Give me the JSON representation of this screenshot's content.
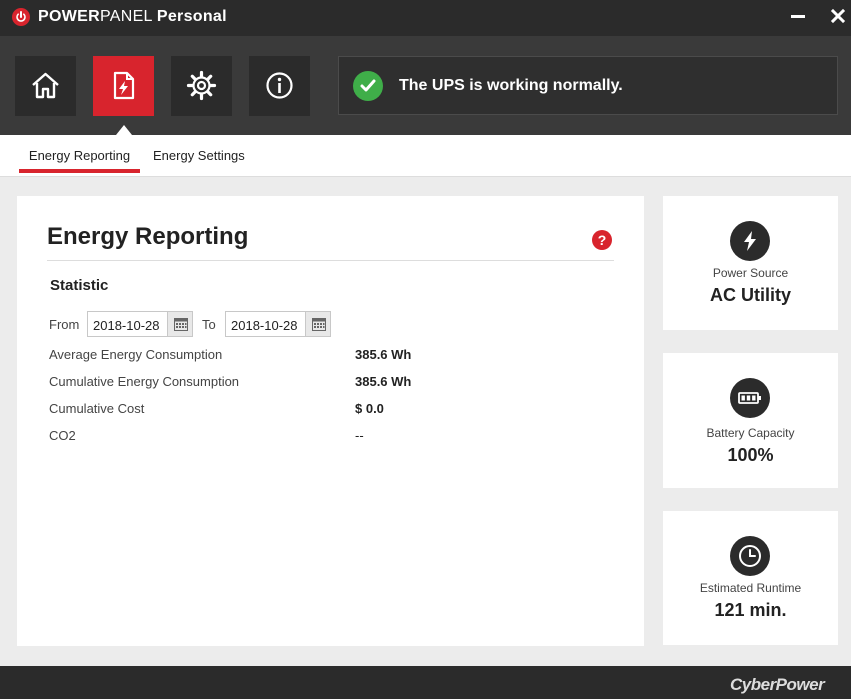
{
  "window": {
    "title_part1": "POWER",
    "title_part2": "PANEL",
    "title_part3": "Personal"
  },
  "nav": {
    "items": [
      {
        "icon": "home-icon"
      },
      {
        "icon": "energy-report-icon",
        "active": true
      },
      {
        "icon": "gear-icon"
      },
      {
        "icon": "info-icon"
      }
    ]
  },
  "status": {
    "message": "The UPS is working normally.",
    "color": "#3fae49"
  },
  "tabs": [
    {
      "label": "Energy Reporting",
      "active": true
    },
    {
      "label": "Energy Settings"
    }
  ],
  "main": {
    "title": "Energy Reporting",
    "help": "?",
    "section": "Statistic",
    "from_label": "From",
    "to_label": "To",
    "from_date": "2018-10-28",
    "to_date": "2018-10-28",
    "stats": [
      {
        "label": "Average Energy Consumption",
        "value": "385.6 Wh"
      },
      {
        "label": "Cumulative Energy Consumption",
        "value": "385.6 Wh"
      },
      {
        "label": "Cumulative Cost",
        "value": "$ 0.0"
      },
      {
        "label": "CO2",
        "value": "--"
      }
    ]
  },
  "cards": [
    {
      "icon": "lightning-icon",
      "label": "Power Source",
      "value": "AC Utility"
    },
    {
      "icon": "battery-icon",
      "label": "Battery Capacity",
      "value": "100%"
    },
    {
      "icon": "clock-icon",
      "label": "Estimated Runtime",
      "value": "121 min."
    }
  ],
  "footer": {
    "brand": "CyberPower"
  },
  "colors": {
    "accent": "#d8242d",
    "dark": "#2b2b2b",
    "band": "#3a3a3a"
  }
}
